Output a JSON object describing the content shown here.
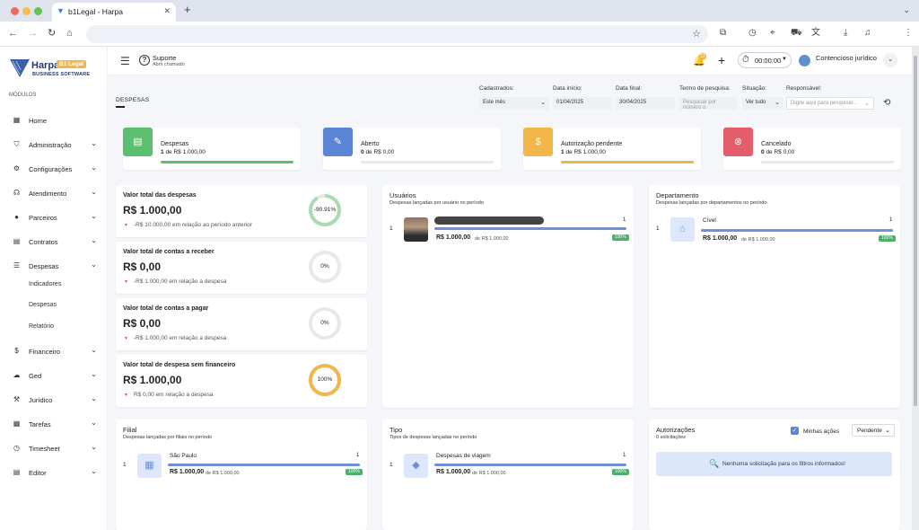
{
  "browser": {
    "tab_title": "b1Legal - Harpa",
    "close_glyph": "✕",
    "new_tab_glyph": "+"
  },
  "colors": {
    "green": "#5cbf6f",
    "blue": "#5b84d6",
    "orange": "#f0b64a",
    "red": "#e35d6a",
    "accent": "#4caf6a"
  },
  "logo": {
    "name": "Harpa",
    "badge": "B1 Legal",
    "subtitle": "BUSINESS SOFTWARE"
  },
  "sidebar": {
    "section_label": "MÓDULOS",
    "items": [
      {
        "label": "Home",
        "icon": "grid-icon"
      },
      {
        "label": "Administração",
        "icon": "shield-icon"
      },
      {
        "label": "Configurações",
        "icon": "gear-icon"
      },
      {
        "label": "Atendimento",
        "icon": "headset-icon"
      },
      {
        "label": "Parceiros",
        "icon": "person-icon"
      },
      {
        "label": "Contratos",
        "icon": "document-icon"
      },
      {
        "label": "Despesas",
        "icon": "list-icon"
      },
      {
        "label": "Financeiro",
        "icon": "dollar-icon"
      },
      {
        "label": "Ged",
        "icon": "cloud-icon"
      },
      {
        "label": "Jurídico",
        "icon": "gavel-icon"
      },
      {
        "label": "Tarefas",
        "icon": "calendar-icon"
      },
      {
        "label": "Timesheet",
        "icon": "clock-icon"
      },
      {
        "label": "Editor",
        "icon": "file-icon"
      }
    ],
    "sub_items": [
      "Indicadores",
      "Despesas",
      "Relatório"
    ]
  },
  "topbar": {
    "support_title": "Suporte",
    "support_sub": "Abrir chamado",
    "notif_count": "11",
    "timer": "00:00:00",
    "user_name": "Contencioso jurídico"
  },
  "page": {
    "breadcrumb": "DESPESAS"
  },
  "filters": {
    "cadastrados_label": "Cadastrados:",
    "cadastrados_value": "Este mês",
    "data_inicio_label": "Data início:",
    "data_inicio_value": "01/04/2025",
    "data_final_label": "Data final:",
    "data_final_value": "30/04/2025",
    "termo_label": "Termo de pesquisa:",
    "termo_placeholder": "Pesquisar por número o",
    "situacao_label": "Situação:",
    "situacao_value": "Ver tudo",
    "responsavel_label": "Responsável:",
    "responsavel_placeholder": "Digite aqui para pesquisar..."
  },
  "stats": [
    {
      "title": "Despesas",
      "count": "1",
      "value_text": "de R$ 1.000,00",
      "fill": 1.0,
      "color": "#5cbf6f",
      "icon": "document-icon"
    },
    {
      "title": "Aberto",
      "count": "0",
      "value_text": "de R$ 0,00",
      "fill": 0,
      "color": "#5b84d6",
      "icon": "edit-check-icon"
    },
    {
      "title": "Autorização pendente",
      "count": "1",
      "value_text": "de R$ 1.000,00",
      "fill": 1.0,
      "color": "#f0b64a",
      "icon": "dollar-circle-icon"
    },
    {
      "title": "Cancelado",
      "count": "0",
      "value_text": "de R$ 0,00",
      "fill": 0,
      "color": "#e35d6a",
      "icon": "x-circle-icon"
    }
  ],
  "kpis": [
    {
      "title": "Valor total das despesas",
      "value": "R$ 1.000,00",
      "compare": "-R$ 10.000,00 em relação ao período anterior",
      "donut_label": "-90.91%",
      "donut_fraction": 0.9091,
      "donut_color": "#a8dbb2"
    },
    {
      "title": "Valor total de contas a receber",
      "value": "R$ 0,00",
      "compare": "-R$ 1.000,00 em relação a despesa",
      "donut_label": "0%",
      "donut_fraction": 0,
      "donut_color": "#e6e8ec"
    },
    {
      "title": "Valor total de contas a pagar",
      "value": "R$ 0,00",
      "compare": "-R$ 1.000,00 em relação a despesa",
      "donut_label": "0%",
      "donut_fraction": 0,
      "donut_color": "#e6e8ec"
    },
    {
      "title": "Valor total de despesa sem financeiro",
      "value": "R$ 1.000,00",
      "compare": "R$ 0,00 em relação a despesa",
      "donut_label": "100%",
      "donut_fraction": 1.0,
      "donut_color": "#f0b64a"
    }
  ],
  "usuarios": {
    "title": "Usuários",
    "subtitle": "Despesas lançadas por usuário no período",
    "rows": [
      {
        "idx": "1",
        "count": "1",
        "value": "R$ 1.000,00",
        "de": "de R$ 1.000,00",
        "pct": "100%"
      }
    ]
  },
  "departamento": {
    "title": "Departamento",
    "subtitle": "Despesas lançadas por departamentos no período",
    "rows": [
      {
        "idx": "1",
        "name": "Cível",
        "count": "1",
        "value": "R$ 1.000,00",
        "de": "de R$ 1.000,00",
        "pct": "100%"
      }
    ]
  },
  "filial": {
    "title": "Filial",
    "subtitle": "Despesas lançadas por filiais no período",
    "rows": [
      {
        "idx": "1",
        "name": "São Paulo",
        "count": "1",
        "value": "R$ 1.000,00",
        "de": "de R$ 1.000,00",
        "pct": "100%"
      }
    ]
  },
  "tipo": {
    "title": "Tipo",
    "subtitle": "Tipos de despesas lançadas no período",
    "rows": [
      {
        "idx": "1",
        "name": "Despesas de viagem",
        "count": "1",
        "value": "R$ 1.000,00",
        "de": "de R$ 1.000,00",
        "pct": "100%"
      }
    ]
  },
  "autorizacoes": {
    "title": "Autorizações",
    "subtitle": "0 solicitações",
    "minhas_acoes": "Minhas ações",
    "status_select": "Pendente",
    "empty_message": "Nenhuma solicitação para os filtros informados!"
  }
}
